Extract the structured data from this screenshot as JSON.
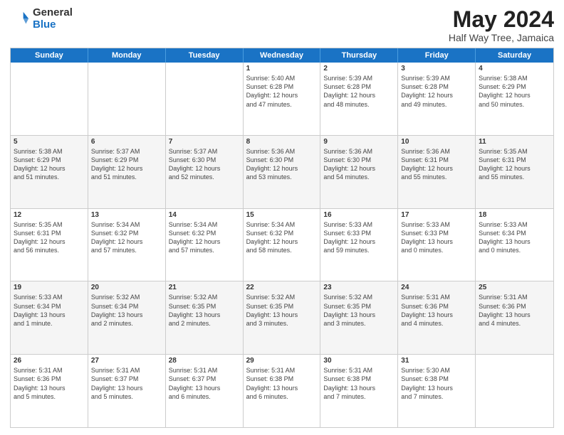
{
  "logo": {
    "general": "General",
    "blue": "Blue"
  },
  "title": {
    "month": "May 2024",
    "location": "Half Way Tree, Jamaica"
  },
  "header": {
    "days": [
      "Sunday",
      "Monday",
      "Tuesday",
      "Wednesday",
      "Thursday",
      "Friday",
      "Saturday"
    ]
  },
  "weeks": [
    [
      {
        "day": "",
        "text": ""
      },
      {
        "day": "",
        "text": ""
      },
      {
        "day": "",
        "text": ""
      },
      {
        "day": "1",
        "text": "Sunrise: 5:40 AM\nSunset: 6:28 PM\nDaylight: 12 hours\nand 47 minutes."
      },
      {
        "day": "2",
        "text": "Sunrise: 5:39 AM\nSunset: 6:28 PM\nDaylight: 12 hours\nand 48 minutes."
      },
      {
        "day": "3",
        "text": "Sunrise: 5:39 AM\nSunset: 6:28 PM\nDaylight: 12 hours\nand 49 minutes."
      },
      {
        "day": "4",
        "text": "Sunrise: 5:38 AM\nSunset: 6:29 PM\nDaylight: 12 hours\nand 50 minutes."
      }
    ],
    [
      {
        "day": "5",
        "text": "Sunrise: 5:38 AM\nSunset: 6:29 PM\nDaylight: 12 hours\nand 51 minutes."
      },
      {
        "day": "6",
        "text": "Sunrise: 5:37 AM\nSunset: 6:29 PM\nDaylight: 12 hours\nand 51 minutes."
      },
      {
        "day": "7",
        "text": "Sunrise: 5:37 AM\nSunset: 6:30 PM\nDaylight: 12 hours\nand 52 minutes."
      },
      {
        "day": "8",
        "text": "Sunrise: 5:36 AM\nSunset: 6:30 PM\nDaylight: 12 hours\nand 53 minutes."
      },
      {
        "day": "9",
        "text": "Sunrise: 5:36 AM\nSunset: 6:30 PM\nDaylight: 12 hours\nand 54 minutes."
      },
      {
        "day": "10",
        "text": "Sunrise: 5:36 AM\nSunset: 6:31 PM\nDaylight: 12 hours\nand 55 minutes."
      },
      {
        "day": "11",
        "text": "Sunrise: 5:35 AM\nSunset: 6:31 PM\nDaylight: 12 hours\nand 55 minutes."
      }
    ],
    [
      {
        "day": "12",
        "text": "Sunrise: 5:35 AM\nSunset: 6:31 PM\nDaylight: 12 hours\nand 56 minutes."
      },
      {
        "day": "13",
        "text": "Sunrise: 5:34 AM\nSunset: 6:32 PM\nDaylight: 12 hours\nand 57 minutes."
      },
      {
        "day": "14",
        "text": "Sunrise: 5:34 AM\nSunset: 6:32 PM\nDaylight: 12 hours\nand 57 minutes."
      },
      {
        "day": "15",
        "text": "Sunrise: 5:34 AM\nSunset: 6:32 PM\nDaylight: 12 hours\nand 58 minutes."
      },
      {
        "day": "16",
        "text": "Sunrise: 5:33 AM\nSunset: 6:33 PM\nDaylight: 12 hours\nand 59 minutes."
      },
      {
        "day": "17",
        "text": "Sunrise: 5:33 AM\nSunset: 6:33 PM\nDaylight: 13 hours\nand 0 minutes."
      },
      {
        "day": "18",
        "text": "Sunrise: 5:33 AM\nSunset: 6:34 PM\nDaylight: 13 hours\nand 0 minutes."
      }
    ],
    [
      {
        "day": "19",
        "text": "Sunrise: 5:33 AM\nSunset: 6:34 PM\nDaylight: 13 hours\nand 1 minute."
      },
      {
        "day": "20",
        "text": "Sunrise: 5:32 AM\nSunset: 6:34 PM\nDaylight: 13 hours\nand 2 minutes."
      },
      {
        "day": "21",
        "text": "Sunrise: 5:32 AM\nSunset: 6:35 PM\nDaylight: 13 hours\nand 2 minutes."
      },
      {
        "day": "22",
        "text": "Sunrise: 5:32 AM\nSunset: 6:35 PM\nDaylight: 13 hours\nand 3 minutes."
      },
      {
        "day": "23",
        "text": "Sunrise: 5:32 AM\nSunset: 6:35 PM\nDaylight: 13 hours\nand 3 minutes."
      },
      {
        "day": "24",
        "text": "Sunrise: 5:31 AM\nSunset: 6:36 PM\nDaylight: 13 hours\nand 4 minutes."
      },
      {
        "day": "25",
        "text": "Sunrise: 5:31 AM\nSunset: 6:36 PM\nDaylight: 13 hours\nand 4 minutes."
      }
    ],
    [
      {
        "day": "26",
        "text": "Sunrise: 5:31 AM\nSunset: 6:36 PM\nDaylight: 13 hours\nand 5 minutes."
      },
      {
        "day": "27",
        "text": "Sunrise: 5:31 AM\nSunset: 6:37 PM\nDaylight: 13 hours\nand 5 minutes."
      },
      {
        "day": "28",
        "text": "Sunrise: 5:31 AM\nSunset: 6:37 PM\nDaylight: 13 hours\nand 6 minutes."
      },
      {
        "day": "29",
        "text": "Sunrise: 5:31 AM\nSunset: 6:38 PM\nDaylight: 13 hours\nand 6 minutes."
      },
      {
        "day": "30",
        "text": "Sunrise: 5:31 AM\nSunset: 6:38 PM\nDaylight: 13 hours\nand 7 minutes."
      },
      {
        "day": "31",
        "text": "Sunrise: 5:30 AM\nSunset: 6:38 PM\nDaylight: 13 hours\nand 7 minutes."
      },
      {
        "day": "",
        "text": ""
      }
    ]
  ]
}
